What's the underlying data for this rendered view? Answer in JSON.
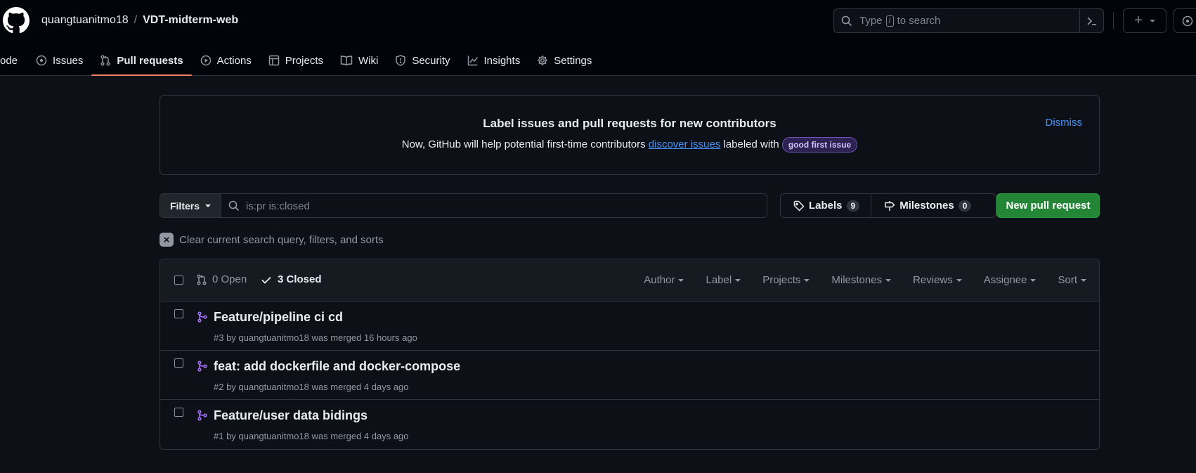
{
  "header": {
    "owner": "quangtuanitmo18",
    "separator": "/",
    "repo": "VDT-midterm-web",
    "search_placeholder_pre": "Type",
    "search_key": "/",
    "search_placeholder_post": "to search",
    "plus": "+"
  },
  "nav": {
    "items": [
      {
        "label": "ode",
        "icon": "code-icon"
      },
      {
        "label": "Issues",
        "icon": "issue-opened-icon"
      },
      {
        "label": "Pull requests",
        "icon": "git-pull-request-icon"
      },
      {
        "label": "Actions",
        "icon": "play-icon"
      },
      {
        "label": "Projects",
        "icon": "table-icon"
      },
      {
        "label": "Wiki",
        "icon": "book-icon"
      },
      {
        "label": "Security",
        "icon": "shield-icon"
      },
      {
        "label": "Insights",
        "icon": "graph-icon"
      },
      {
        "label": "Settings",
        "icon": "gear-icon"
      }
    ],
    "selected": "Pull requests"
  },
  "banner": {
    "title": "Label issues and pull requests for new contributors",
    "text_pre": "Now, GitHub will help potential first-time contributors",
    "link": "discover issues",
    "text_post": "labeled with",
    "label": "good first issue",
    "dismiss": "Dismiss"
  },
  "toolbar": {
    "filters": "Filters",
    "query": "is:pr is:closed",
    "labels": "Labels",
    "labels_count": "9",
    "milestones": "Milestones",
    "milestones_count": "0",
    "new_pr": "New pull request",
    "clear": "Clear current search query, filters, and sorts"
  },
  "list": {
    "open": "0 Open",
    "closed": "3 Closed",
    "filters": [
      "Author",
      "Label",
      "Projects",
      "Milestones",
      "Reviews",
      "Assignee",
      "Sort"
    ],
    "prs": [
      {
        "title": "Feature/pipeline ci cd",
        "meta": "#3 by quangtuanitmo18 was merged 16 hours ago"
      },
      {
        "title": "feat: add dockerfile and docker-compose",
        "meta": "#2 by quangtuanitmo18 was merged 4 days ago"
      },
      {
        "title": "Feature/user data bidings",
        "meta": "#1 by quangtuanitmo18 was merged 4 days ago"
      }
    ]
  },
  "colors": {
    "background": "#0d1117",
    "accent_link": "#4493f8",
    "merged": "#a371f7",
    "primary_button": "#238636",
    "nav_underline": "#f78166"
  }
}
